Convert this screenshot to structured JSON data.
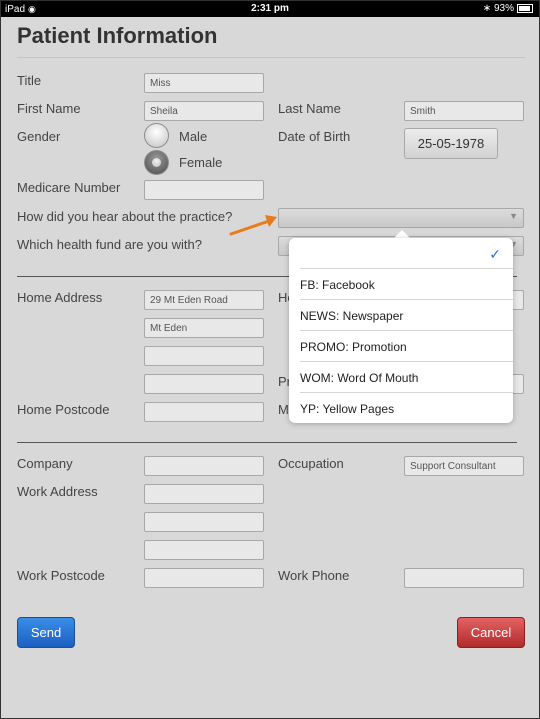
{
  "status_bar": {
    "carrier": "iPad",
    "time": "2:31 pm",
    "battery": "93%"
  },
  "page": {
    "title": "Patient Information"
  },
  "labels": {
    "title": "Title",
    "first_name": "First Name",
    "last_name": "Last Name",
    "gender": "Gender",
    "date_of_birth": "Date of Birth",
    "medicare": "Medicare Number",
    "hear_about": "How did you hear about the practice?",
    "health_fund": "Which health fund are you with?",
    "home_address": "Home Address",
    "home_postcode": "Home Postcode",
    "company": "Company",
    "occupation": "Occupation",
    "work_address": "Work Address",
    "work_postcode": "Work Postcode",
    "work_phone": "Work Phone",
    "obscured_h1": "Ho",
    "obscured_pr": "Pr",
    "obscured_m": "M"
  },
  "values": {
    "title": "Miss",
    "first_name": "Sheila",
    "last_name": "Smith",
    "date_of_birth": "25-05-1978",
    "home_address_1": "29 Mt Eden Road",
    "home_address_2": "Mt Eden",
    "occupation": "Support Consultant"
  },
  "gender": {
    "options": [
      "Male",
      "Female"
    ],
    "selected": "Female"
  },
  "dropdown": {
    "options": [
      "FB: Facebook",
      "NEWS: Newspaper",
      "PROMO: Promotion",
      "WOM: Word Of Mouth",
      "YP: Yellow Pages"
    ]
  },
  "buttons": {
    "send": "Send",
    "cancel": "Cancel"
  },
  "colors": {
    "accent_blue": "#1d5fc2",
    "cancel_red": "#b12b2b",
    "arrow": "#e87b1e",
    "check": "#1a74d8"
  }
}
